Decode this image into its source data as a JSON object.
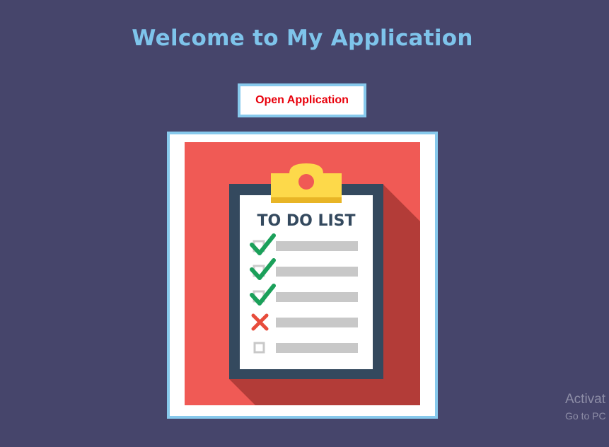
{
  "header": {
    "title": "Welcome to My Application"
  },
  "actions": {
    "open_label": "Open Application"
  },
  "illustration": {
    "heading": "TO DO LIST",
    "items": [
      {
        "status": "done",
        "icon": "check-icon"
      },
      {
        "status": "done",
        "icon": "check-icon"
      },
      {
        "status": "done",
        "icon": "check-icon"
      },
      {
        "status": "failed",
        "icon": "cross-icon"
      },
      {
        "status": "pending",
        "icon": "empty-checkbox-icon"
      }
    ],
    "colors": {
      "background": "#f05a55",
      "shadow": "#b33c38",
      "board": "#34495e",
      "paper": "#ffffff",
      "clip": "#fdd94a",
      "check": "#1ba05a",
      "cross": "#e74c3c",
      "bar": "#c8c8c8"
    }
  },
  "watermark": {
    "title": "Activat",
    "subtitle": "Go to PC"
  },
  "colors": {
    "page_background": "#46456b",
    "title": "#7ec4eb",
    "button_text": "#e8000b",
    "frame_border": "#87c9ec"
  }
}
